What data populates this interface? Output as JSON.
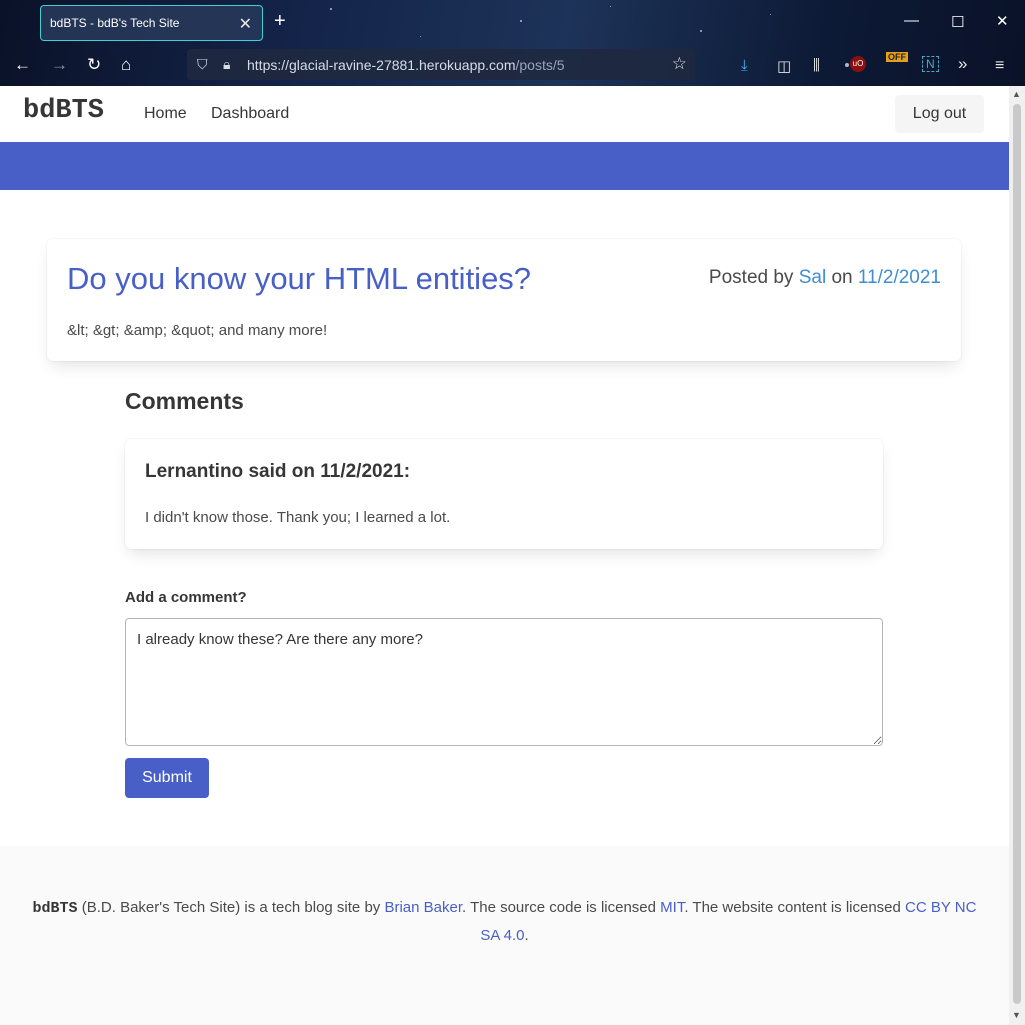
{
  "browser": {
    "tab_title": "bdBTS - bdB's Tech Site",
    "url_host": "https://glacial-ravine-27881.herokuapp.com",
    "url_path": "/posts/5",
    "extension_badge": "OFF",
    "icons": [
      "back-icon",
      "forward-icon",
      "reload-icon",
      "home-icon",
      "shield-icon",
      "lock-icon",
      "bookmark-star-icon",
      "download-icon",
      "sidebar-icon",
      "library-icon",
      "ublock-icon",
      "extension-off-icon",
      "extension-n-icon",
      "overflow-icon",
      "menu-icon"
    ]
  },
  "nav": {
    "brand": "bdBTS",
    "links": [
      "Home",
      "Dashboard"
    ],
    "logout": "Log out"
  },
  "post": {
    "title": "Do you know your HTML entities?",
    "posted_by_prefix": "Posted by",
    "author": "Sal",
    "on_word": "on",
    "date": "11/2/2021",
    "body": "&lt; &gt; &amp; &quot; and many more!"
  },
  "comments": {
    "heading": "Comments",
    "items": [
      {
        "header": "Lernantino said on 11/2/2021:",
        "body": "I didn't know those. Thank you; I learned a lot."
      }
    ]
  },
  "comment_form": {
    "label": "Add a comment?",
    "value": "I already know these? Are there any more?",
    "submit": "Submit"
  },
  "footer": {
    "brand": "bdBTS",
    "text1": " (B.D. Baker's Tech Site) is a tech blog site by ",
    "author_link": "Brian Baker",
    "text2": ". The source code is licensed ",
    "code_license": "MIT",
    "text3": ". The website content is licensed ",
    "content_license": "CC BY NC SA 4.0",
    "text4": "."
  },
  "colors": {
    "primary": "#485fc7",
    "link": "#3e8ed0"
  }
}
